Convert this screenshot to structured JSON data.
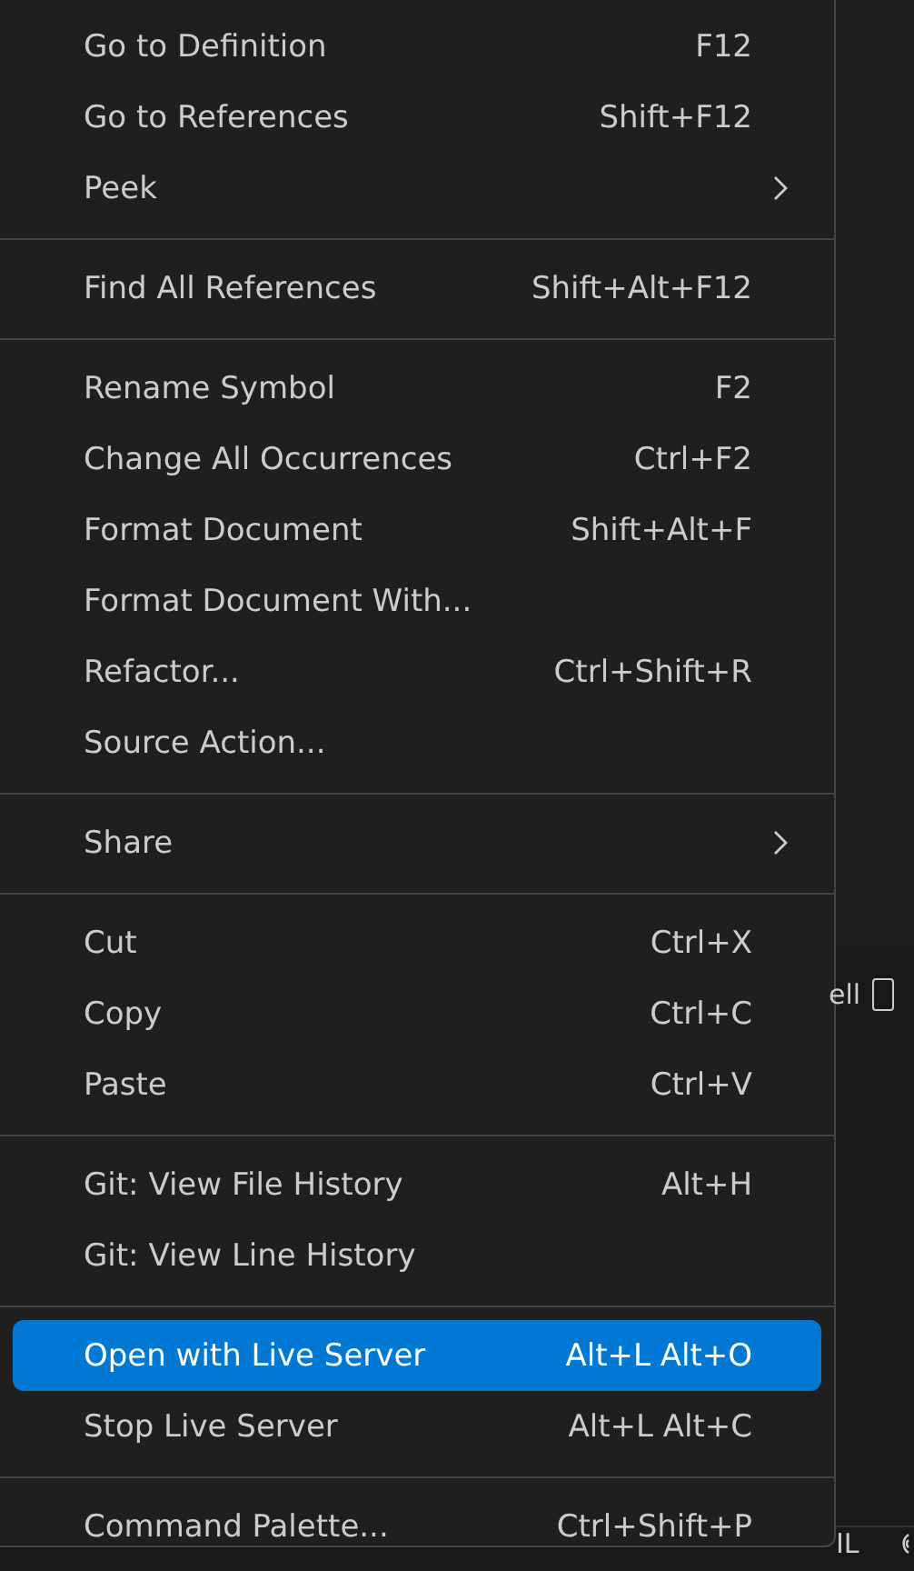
{
  "context_menu": {
    "groups": [
      {
        "items": [
          {
            "label": "Go to Definition",
            "shortcut": "F12",
            "submenu": false,
            "selected": false
          },
          {
            "label": "Go to References",
            "shortcut": "Shift+F12",
            "submenu": false,
            "selected": false
          },
          {
            "label": "Peek",
            "submenu": true,
            "selected": false
          }
        ]
      },
      {
        "items": [
          {
            "label": "Find All References",
            "shortcut": "Shift+Alt+F12",
            "submenu": false,
            "selected": false
          }
        ]
      },
      {
        "items": [
          {
            "label": "Rename Symbol",
            "shortcut": "F2",
            "submenu": false,
            "selected": false
          },
          {
            "label": "Change All Occurrences",
            "shortcut": "Ctrl+F2",
            "submenu": false,
            "selected": false
          },
          {
            "label": "Format Document",
            "shortcut": "Shift+Alt+F",
            "submenu": false,
            "selected": false
          },
          {
            "label": "Format Document With...",
            "submenu": false,
            "selected": false
          },
          {
            "label": "Refactor...",
            "shortcut": "Ctrl+Shift+R",
            "submenu": false,
            "selected": false
          },
          {
            "label": "Source Action...",
            "submenu": false,
            "selected": false
          }
        ]
      },
      {
        "items": [
          {
            "label": "Share",
            "submenu": true,
            "selected": false
          }
        ]
      },
      {
        "items": [
          {
            "label": "Cut",
            "shortcut": "Ctrl+X",
            "submenu": false,
            "selected": false
          },
          {
            "label": "Copy",
            "shortcut": "Ctrl+C",
            "submenu": false,
            "selected": false
          },
          {
            "label": "Paste",
            "shortcut": "Ctrl+V",
            "submenu": false,
            "selected": false
          }
        ]
      },
      {
        "items": [
          {
            "label": "Git: View File History",
            "shortcut": "Alt+H",
            "submenu": false,
            "selected": false
          },
          {
            "label": "Git: View Line History",
            "submenu": false,
            "selected": false
          }
        ]
      },
      {
        "items": [
          {
            "label": "Open with Live Server",
            "shortcut": "Alt+L Alt+O",
            "submenu": false,
            "selected": true
          },
          {
            "label": "Stop Live Server",
            "shortcut": "Alt+L Alt+C",
            "submenu": false,
            "selected": false
          }
        ]
      },
      {
        "items": [
          {
            "label": "Command Palette...",
            "shortcut": "Ctrl+Shift+P",
            "submenu": false,
            "selected": false
          }
        ]
      }
    ]
  },
  "background": {
    "panel_tab_text": "ell",
    "status_text": "IL"
  }
}
